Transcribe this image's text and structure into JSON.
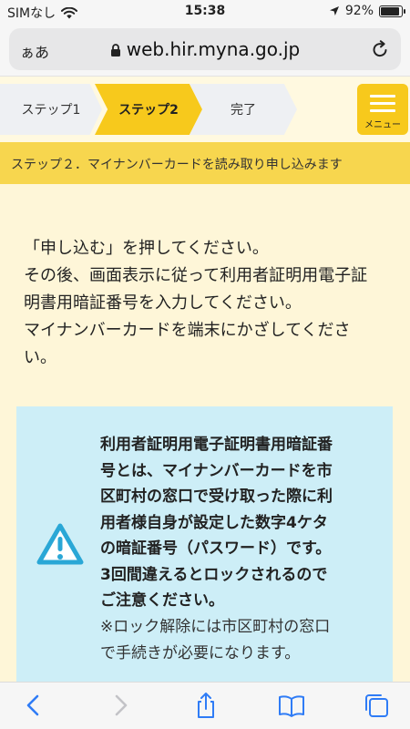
{
  "status_bar": {
    "carrier": "SIMなし",
    "time": "15:38",
    "battery_text": "92%",
    "battery_level": 0.92
  },
  "address_bar": {
    "text_size_label": "ぁあ",
    "url": "web.hir.myna.go.jp"
  },
  "steps": [
    {
      "label": "ステップ1",
      "state": "done"
    },
    {
      "label": "ステップ2",
      "state": "current"
    },
    {
      "label": "完了",
      "state": "todo"
    }
  ],
  "menu": {
    "label": "メニュー"
  },
  "banner": {
    "text": "ステップ２．マイナンバーカードを読み取り申し込みます"
  },
  "instructions": {
    "lines": [
      "「申し込む」を押してください。",
      "その後、画面表示に従って利用者証明用電子証",
      "明書用暗証番号を入力してください。",
      "マイナンバーカードを端末にかざしてくださ",
      "い。"
    ]
  },
  "notice": {
    "icon": "warning-icon",
    "bold_lines": [
      "利用者証明用電子証明書用暗証番",
      "号とは、マイナンバーカードを市",
      "区町村の窓口で受け取った際に利",
      "用者様自身が設定した数字4ケタ",
      "の暗証番号（パスワード）です。",
      "3回間違えるとロックされるので",
      "ご注意ください。"
    ],
    "note_lines": [
      "※ロック解除には市区町村の窓口",
      "で手続きが必要になります。"
    ]
  },
  "colors": {
    "accent_yellow": "#f7c91c",
    "banner_yellow": "#f7d64e",
    "page_background": "#fef6d8",
    "notice_background": "#cdeef7",
    "toolbar_blue": "#2f7cf6"
  }
}
